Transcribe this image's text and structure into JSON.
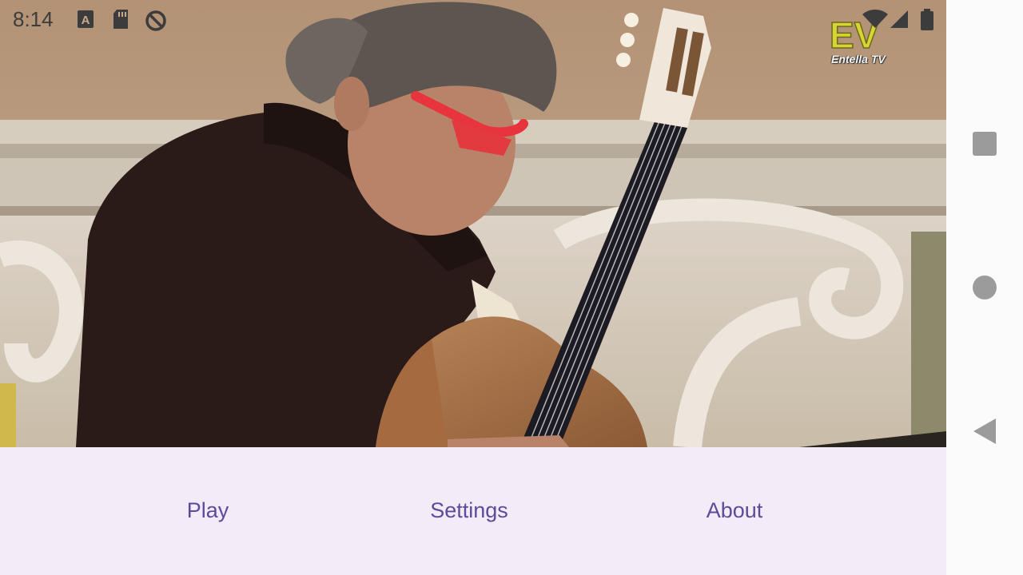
{
  "status_bar": {
    "time": "8:14",
    "left_icons": [
      "font-icon",
      "sd-card-icon",
      "sync-off-icon"
    ],
    "right_icons": [
      "wifi-icon",
      "cell-signal-icon",
      "battery-icon"
    ]
  },
  "video": {
    "channel_logo": {
      "mark": "EV",
      "name": "Entella TV",
      "accent_color": "#d8d434"
    }
  },
  "bottom_nav": {
    "items": [
      {
        "label": "Play"
      },
      {
        "label": "Settings"
      },
      {
        "label": "About"
      }
    ],
    "background_color": "#f3ecf8",
    "text_color": "#5d4a9a"
  },
  "system_nav": {
    "buttons": [
      "recents-button",
      "home-button",
      "back-button"
    ]
  }
}
